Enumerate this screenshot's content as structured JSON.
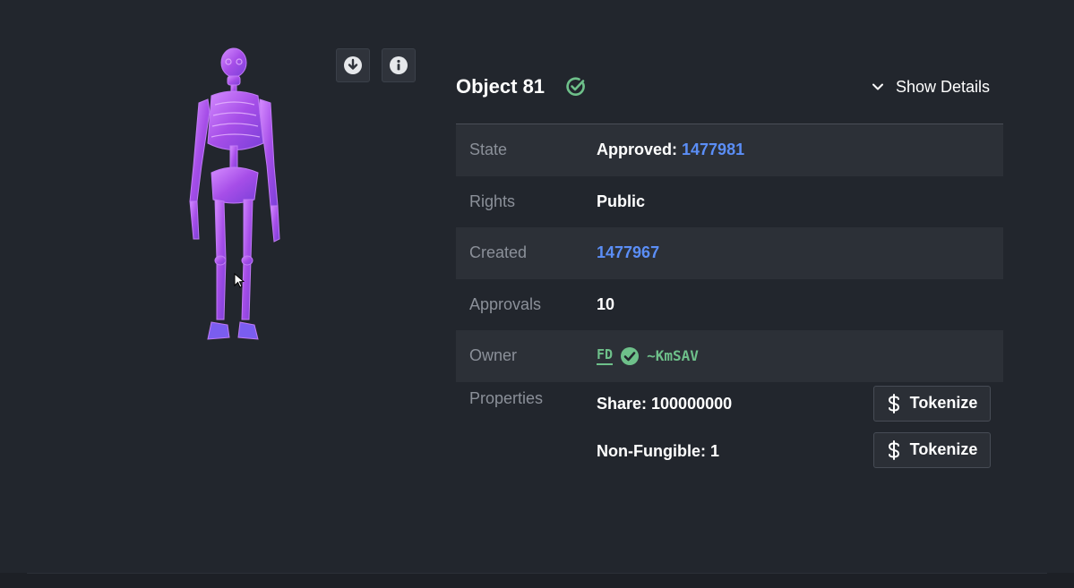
{
  "object": {
    "title": "Object 81",
    "show_details_label": "Show Details"
  },
  "toolbar": {
    "download_icon": "download-icon",
    "info_icon": "info-icon"
  },
  "details": {
    "state": {
      "key": "State",
      "value_prefix": "Approved:",
      "value_link": "1477981"
    },
    "rights": {
      "key": "Rights",
      "value": "Public"
    },
    "created": {
      "key": "Created",
      "value_link": "1477967"
    },
    "approvals": {
      "key": "Approvals",
      "value": "10"
    },
    "owner": {
      "key": "Owner",
      "badge": "FD",
      "address": "~KmSAV"
    },
    "properties": {
      "key": "Properties",
      "items": [
        {
          "label": "Share: 100000000",
          "button": "Tokenize"
        },
        {
          "label": "Non-Fungible: 1",
          "button": "Tokenize"
        }
      ]
    }
  },
  "colors": {
    "accent_link": "#5b8ef7",
    "success_green": "#6ec08a",
    "skeleton_purple": "#b05cf0"
  }
}
